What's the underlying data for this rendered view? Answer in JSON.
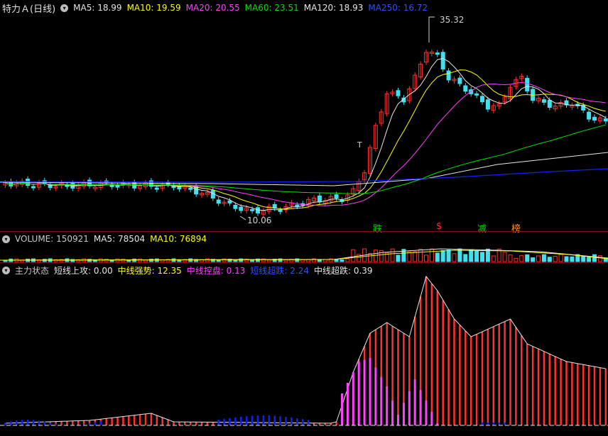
{
  "main_panel": {
    "title": "特力Ａ(日线)",
    "toggle_icon": "chevron-down-icon",
    "ma": [
      {
        "label": "MA5: 18.99",
        "color": "#e6e6e6"
      },
      {
        "label": "MA10: 19.59",
        "color": "#ffff00"
      },
      {
        "label": "MA20: 20.55",
        "color": "#ff40ff"
      },
      {
        "label": "MA60: 23.51",
        "color": "#00e000"
      },
      {
        "label": "MA120: 18.93",
        "color": "#e6e6e6"
      },
      {
        "label": "MA250: 16.72",
        "color": "#3050ff"
      }
    ],
    "high_label": "35.32",
    "low_label": "10.06",
    "t_label": "T",
    "signals": [
      {
        "text": "跌",
        "color": "#00d000"
      },
      {
        "text": "$",
        "color": "#ff3030"
      },
      {
        "text": "减",
        "color": "#00d000"
      },
      {
        "text": "榜",
        "color": "#ff9020"
      }
    ]
  },
  "volume_panel": {
    "title": "VOLUME: 150921",
    "ma5": "MA5: 78504",
    "ma10": "MA10: 76894",
    "ma5_color": "#e6e6e6",
    "ma10_color": "#ffff00"
  },
  "indicator_panel": {
    "title": "主力状态",
    "items": [
      {
        "label": "短线上攻: 0.00",
        "color": "#e6e6e6"
      },
      {
        "label": "中线强势: 12.35",
        "color": "#ffff00"
      },
      {
        "label": "中线控盘: 0.13",
        "color": "#ff40ff"
      },
      {
        "label": "短线超跌: 2.24",
        "color": "#3050ff"
      },
      {
        "label": "中线超跌: 0.39",
        "color": "#e6e6e6"
      }
    ]
  },
  "colors": {
    "up": "#ff3030",
    "down": "#40e0f0",
    "bg": "#000000",
    "magenta": "#ff40ff",
    "blue": "#1020ff"
  }
}
